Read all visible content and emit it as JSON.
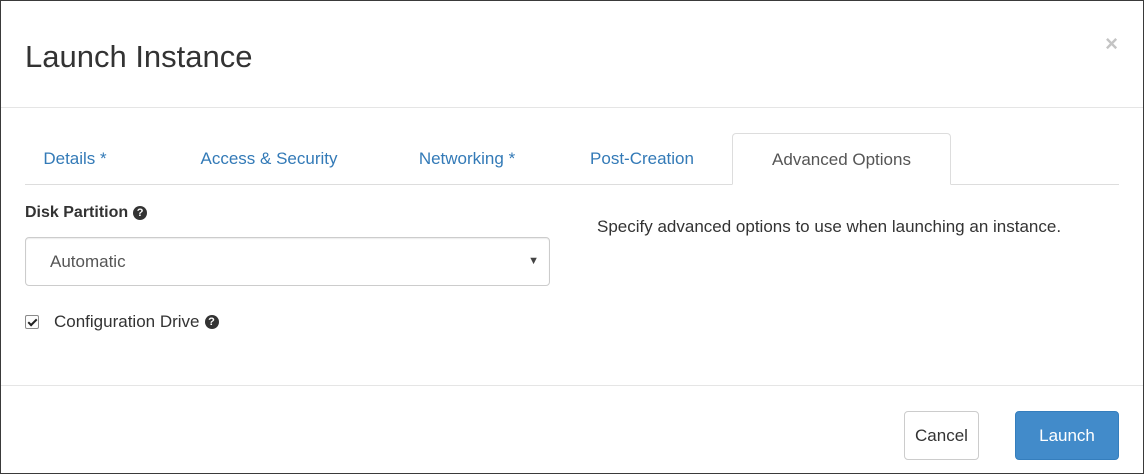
{
  "dialog": {
    "title": "Launch Instance",
    "close_glyph": "×"
  },
  "tabs": [
    {
      "label": "Details *",
      "active": false
    },
    {
      "label": "Access & Security",
      "active": false
    },
    {
      "label": "Networking *",
      "active": false
    },
    {
      "label": "Post-Creation",
      "active": false
    },
    {
      "label": "Advanced Options",
      "active": true
    }
  ],
  "form": {
    "disk_partition_label": "Disk Partition",
    "disk_partition_value": "Automatic",
    "config_drive_label": "Configuration Drive",
    "config_drive_checked": true
  },
  "help_text": "Specify advanced options to use when launching an instance.",
  "footer": {
    "cancel_label": "Cancel",
    "launch_label": "Launch"
  },
  "colors": {
    "link": "#337ab7",
    "primary": "#428bca"
  }
}
